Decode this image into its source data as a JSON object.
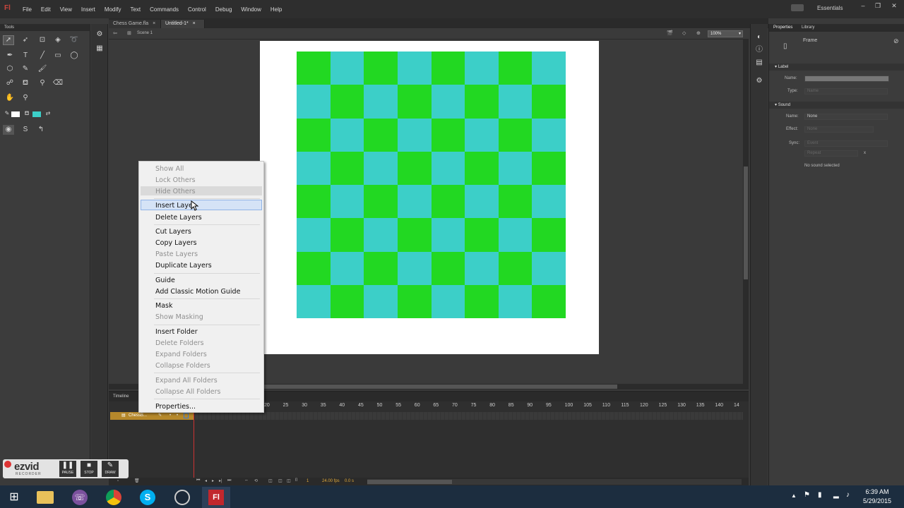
{
  "app": {
    "logo": "Fl",
    "menus": [
      "File",
      "Edit",
      "View",
      "Insert",
      "Modify",
      "Text",
      "Commands",
      "Control",
      "Debug",
      "Window",
      "Help"
    ],
    "workspace": "Essentials"
  },
  "tabs": [
    {
      "label": "Chess Game.fla"
    },
    {
      "label": "Untitled-1*"
    }
  ],
  "edit_bar": {
    "scene": "Scene 1",
    "zoom": "100%"
  },
  "tools_panel": {
    "title": "Tools"
  },
  "board": {
    "rows": 8,
    "cols": 8,
    "color_a": "#22d822",
    "color_b": "#3ccfc8"
  },
  "timeline": {
    "title": "Timeline",
    "layer_name": "ChessB...",
    "frame_numbers": [
      "20",
      "25",
      "30",
      "35",
      "40",
      "45",
      "50",
      "55",
      "60",
      "65",
      "70",
      "75",
      "80",
      "85",
      "90",
      "95",
      "100",
      "105",
      "110",
      "115",
      "120",
      "125",
      "130",
      "135",
      "140",
      "14"
    ],
    "current_frame": "1",
    "fps": "24.00 fps",
    "time": "0.0 s"
  },
  "properties": {
    "tabs": [
      "Properties",
      "Library"
    ],
    "object": "Frame",
    "label_section": "Label",
    "label_name_label": "Name:",
    "label_type_label": "Type:",
    "label_type_value": "Name",
    "sound_section": "Sound",
    "sound_name_label": "Name:",
    "sound_name_value": "None",
    "effect_label": "Effect:",
    "effect_value": "None",
    "sync_label": "Sync:",
    "sync_value": "Event",
    "repeat_value": "Repeat",
    "repeat_count": "x",
    "no_sound": "No sound selected"
  },
  "context_menu": {
    "items": [
      {
        "label": "Show All",
        "enabled": false
      },
      {
        "label": "Lock Others",
        "enabled": false
      },
      {
        "label": "Hide Others",
        "enabled": false
      },
      {
        "label": "Insert Layer",
        "enabled": true,
        "highlighted": true
      },
      {
        "label": "Delete Layers",
        "enabled": true
      },
      {
        "label": "Cut Layers",
        "enabled": true
      },
      {
        "label": "Copy Layers",
        "enabled": true
      },
      {
        "label": "Paste Layers",
        "enabled": false
      },
      {
        "label": "Duplicate Layers",
        "enabled": true
      },
      {
        "label": "Guide",
        "enabled": true
      },
      {
        "label": "Add Classic Motion Guide",
        "enabled": true
      },
      {
        "label": "Mask",
        "enabled": true
      },
      {
        "label": "Show Masking",
        "enabled": false
      },
      {
        "label": "Insert Folder",
        "enabled": true
      },
      {
        "label": "Delete Folders",
        "enabled": false
      },
      {
        "label": "Expand Folders",
        "enabled": false
      },
      {
        "label": "Collapse Folders",
        "enabled": false
      },
      {
        "label": "Expand All Folders",
        "enabled": false
      },
      {
        "label": "Collapse All Folders",
        "enabled": false
      },
      {
        "label": "Properties...",
        "enabled": true
      }
    ]
  },
  "ezvid": {
    "brand": "ezvid",
    "subtitle": "RECORDER",
    "buttons": [
      "PAUSE",
      "STOP",
      "DRAW"
    ]
  },
  "taskbar": {
    "time": "6:39 AM",
    "date": "5/29/2015"
  }
}
